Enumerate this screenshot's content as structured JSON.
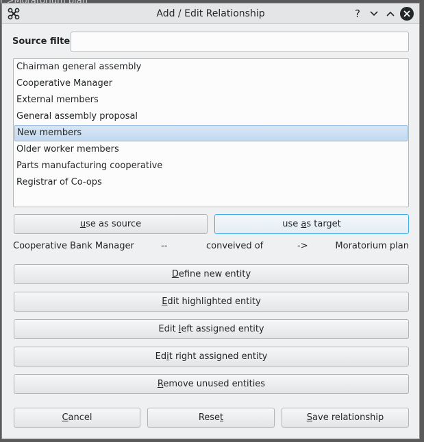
{
  "background_app": {
    "visible_text": "r   >Moratorium plan"
  },
  "titlebar": {
    "title": "Add / Edit Relationship",
    "help_glyph": "?",
    "minimize_glyph": "∨",
    "maximize_glyph": "∧"
  },
  "source_filter": {
    "label": "Source filter:",
    "value": "",
    "placeholder": ""
  },
  "entities": [
    {
      "label": "Chairman general assembly",
      "selected": false
    },
    {
      "label": "Cooperative Manager",
      "selected": false
    },
    {
      "label": "External members",
      "selected": false
    },
    {
      "label": "General assembly proposal",
      "selected": false
    },
    {
      "label": "New members",
      "selected": true
    },
    {
      "label": "Older worker members",
      "selected": false
    },
    {
      "label": "Parts manufacturing cooperative",
      "selected": false
    },
    {
      "label": "Registrar of Co-ops",
      "selected": false
    }
  ],
  "assign_buttons": {
    "source": {
      "pre": "",
      "accel": "u",
      "post": "se as source"
    },
    "target": {
      "pre": "use ",
      "accel": "a",
      "post": "s target"
    }
  },
  "relationship": {
    "source": "Cooperative Bank Manager",
    "sep1": "--",
    "verb": "conveived of",
    "sep2": "->",
    "target": "Moratorium plan"
  },
  "actions": {
    "define_new": {
      "pre": "",
      "accel": "D",
      "post": "efine new entity"
    },
    "edit_highlighted": {
      "pre": "",
      "accel": "E",
      "post": "dit highlighted entity"
    },
    "edit_left": {
      "pre": "Edit ",
      "accel": "l",
      "post": "eft assigned entity"
    },
    "edit_right": {
      "pre": "Ed",
      "accel": "i",
      "post": "t right assigned entity"
    },
    "remove_unused": {
      "pre": "",
      "accel": "R",
      "post": "emove unused entities"
    }
  },
  "footer": {
    "cancel": {
      "pre": "",
      "accel": "C",
      "post": "ancel"
    },
    "reset": {
      "pre": "Rese",
      "accel": "t",
      "post": ""
    },
    "save": {
      "pre": "",
      "accel": "S",
      "post": "ave relationship"
    }
  },
  "colors": {
    "window_bg": "#eff0f1",
    "focus_accent": "#3daee9",
    "selection_bg": "#c3d9f0"
  }
}
